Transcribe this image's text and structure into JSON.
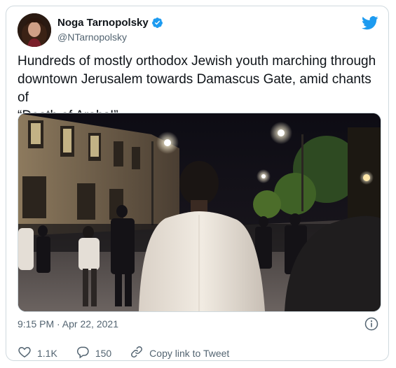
{
  "author": {
    "display_name": "Noga Tarnopolsky",
    "handle": "@NTarnopolsky",
    "verified": true
  },
  "tweet": {
    "text": "Hundreds of mostly orthodox Jewish youth marching through\ndowntown Jerusalem towards Damascus Gate, amid chants of\n“Death of Arabs!”",
    "timestamp": "9:15 PM · Apr 22, 2021"
  },
  "actions": {
    "likes": "1.1K",
    "replies": "150",
    "share_label": "Copy link to Tweet"
  },
  "icons": {
    "logo": "twitter-bird-icon",
    "verified": "verified-badge-icon",
    "info": "info-icon",
    "like": "heart-icon",
    "reply": "reply-icon",
    "share": "link-icon"
  },
  "colors": {
    "brand": "#1d9bf0",
    "secondary_text": "#536471",
    "border": "#cfd9de"
  }
}
